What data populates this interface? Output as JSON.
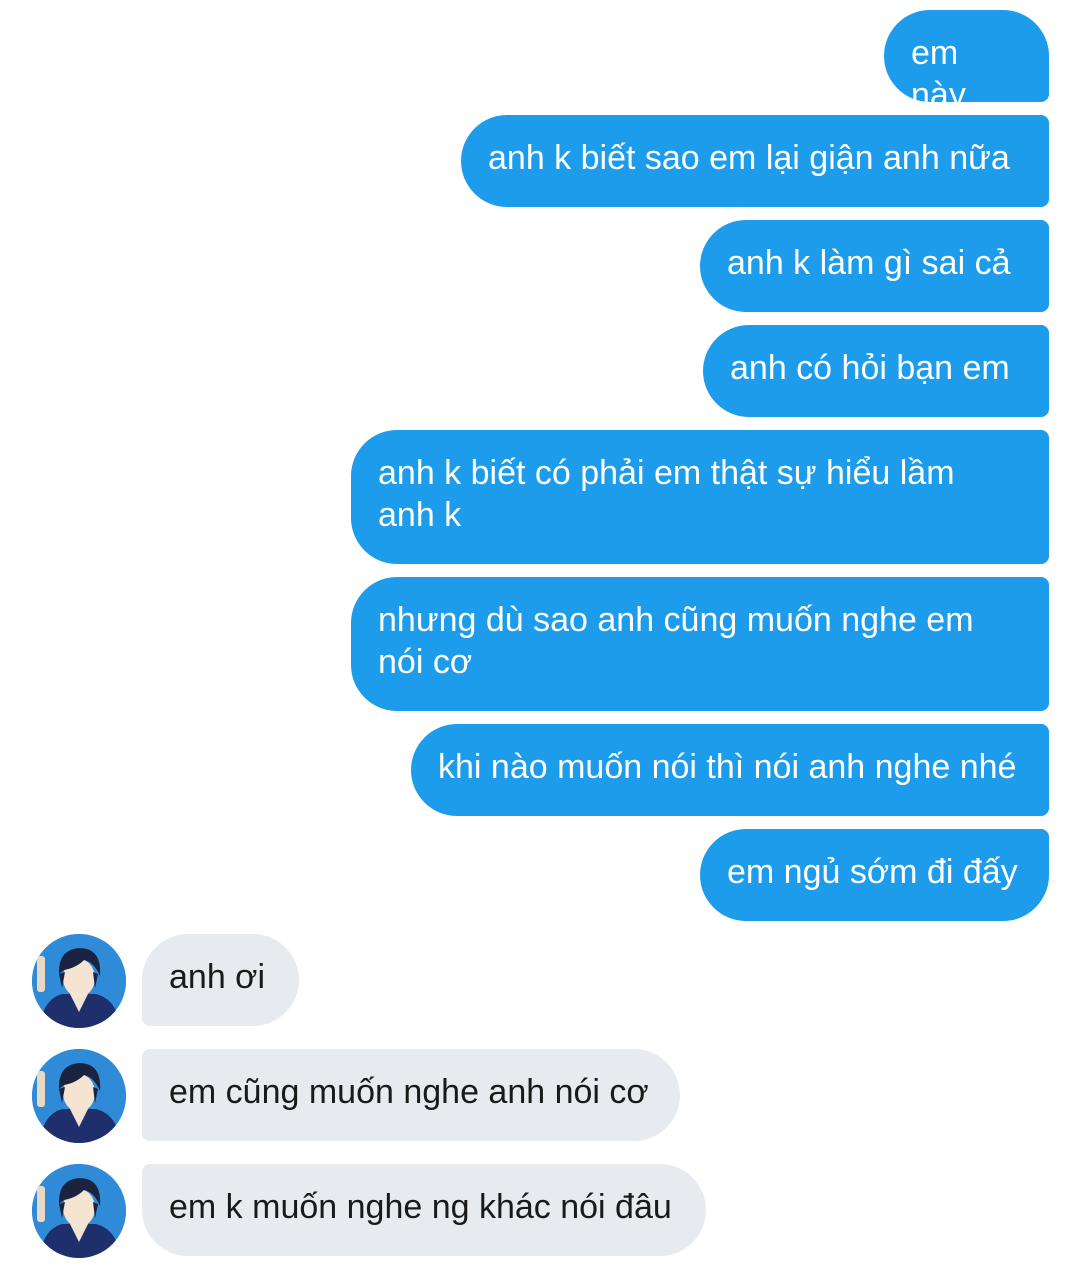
{
  "conversation": {
    "outgoing": [
      {
        "text": "em này"
      },
      {
        "text": "anh k biết sao em lại giận anh nữa"
      },
      {
        "text": "anh k làm gì sai cả"
      },
      {
        "text": "anh có hỏi bạn em"
      },
      {
        "text": "anh k biết có phải em thật sự hiểu lầm anh k"
      },
      {
        "text": "nhưng dù sao anh cũng muốn nghe em nói cơ"
      },
      {
        "text": "khi nào muốn nói thì nói anh nghe nhé"
      },
      {
        "text": "em ngủ sớm đi đấy"
      }
    ],
    "incoming": [
      {
        "text": "anh ơi",
        "avatar_icon": "user-avatar-icon"
      },
      {
        "text": "em cũng muốn nghe anh nói cơ",
        "avatar_icon": "user-avatar-icon"
      },
      {
        "text": "em k muốn nghe ng khác nói đâu",
        "avatar_icon": "user-avatar-icon"
      }
    ]
  },
  "colors": {
    "outgoing_bubble": "#1c9cea",
    "outgoing_text": "#ffffff",
    "incoming_bubble": "#e7ebef",
    "incoming_text": "#1a1a1a",
    "background": "#ffffff"
  }
}
